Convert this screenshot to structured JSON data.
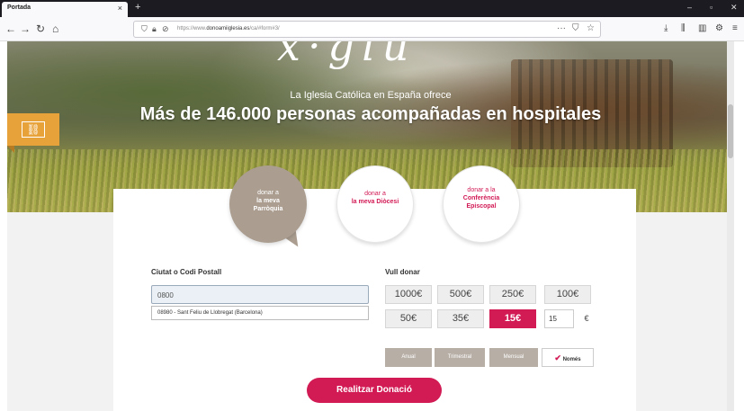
{
  "browser": {
    "tab_title": "Portada",
    "tab_close": "×",
    "new_tab": "+",
    "window_controls": [
      "‒",
      "▫",
      "✕"
    ],
    "url": "https://www.",
    "url_domain": "donoamiiglesia.es",
    "url_path": "/ca/#form#3/"
  },
  "hero": {
    "logo_text": "x·giu",
    "subtitle": "La Iglesia Católica en España ofrece",
    "title": "Más de 146.000 personas acompañadas en hospitales"
  },
  "circles": [
    {
      "line1": "donar a",
      "line2": "la meva",
      "line3": "Parròquia"
    },
    {
      "line1": "donar a",
      "line2": "la meva Diòcesi"
    },
    {
      "line1": "donar a la",
      "line2": "Conferència",
      "line3": "Episcopal"
    }
  ],
  "form": {
    "city_label": "Ciutat o Codi Postall",
    "city_value": "0800",
    "city_suggestion": "08980 - Sant Feliu de Llobregat (Barcelona)",
    "amount_label": "Vull donar",
    "amounts": [
      "1000€",
      "500€",
      "250€",
      "100€",
      "50€",
      "35€",
      "15€"
    ],
    "selected_amount": "15€",
    "custom_amount": "15",
    "currency": "€",
    "frequency": [
      "Anual",
      "Trimestral",
      "Mensual",
      "Només"
    ],
    "selected_frequency": "Només",
    "check_mark": "✔",
    "submit_label": "Realitzar Donació"
  },
  "colors": {
    "accent": "#d21a55",
    "share": "#e8a23a",
    "parish_circle": "#ab9e91"
  }
}
